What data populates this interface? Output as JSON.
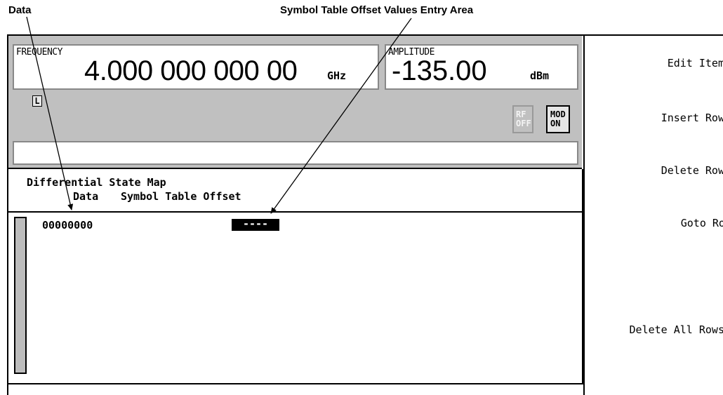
{
  "callouts": {
    "data": "Data",
    "symbol_table_offset": "Symbol Table Offset Values Entry Area"
  },
  "status": {
    "frequency_label": "FREQUENCY",
    "frequency_value": "4.000 000 000 00",
    "frequency_unit": "GHz",
    "amplitude_label": "AMPLITUDE",
    "amplitude_value": "-135.00",
    "amplitude_unit": "dBm",
    "local_indicator": "L",
    "rf_line1": "RF",
    "rf_line2": "OFF",
    "mod_line1": "MOD",
    "mod_line2": "ON",
    "message": ""
  },
  "table": {
    "title": "Differential State Map",
    "columns": [
      "Data",
      "Symbol Table Offset"
    ],
    "rows": [
      {
        "data": "00000000",
        "offset": "----"
      }
    ]
  },
  "softkeys": [
    "Edit Item",
    "Insert Row",
    "Delete Row",
    "Goto Row",
    "Delete All Rows"
  ],
  "colors": {
    "panel_gray": "#c0c0c0",
    "highlight": "#000000"
  }
}
